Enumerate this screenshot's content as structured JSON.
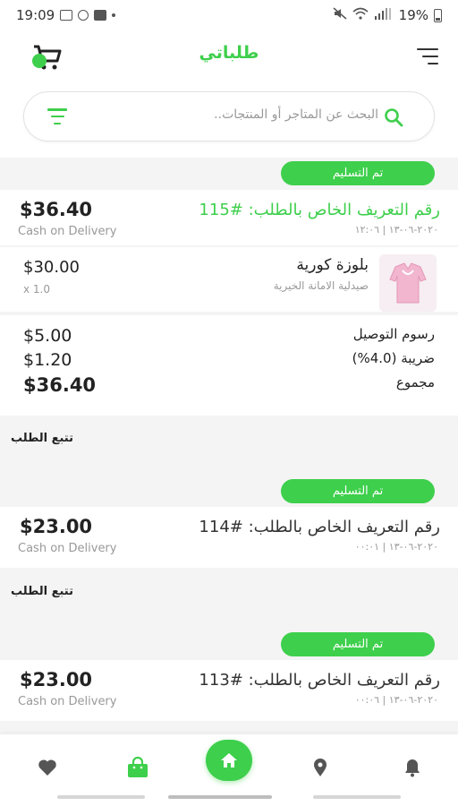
{
  "statusbar": {
    "time": "19:09",
    "battery": "19%"
  },
  "app": {
    "title": "طلباتي"
  },
  "search": {
    "placeholder": "البحث عن المتاجر أو المنتجات.."
  },
  "colors": {
    "accent": "#3ecf4c"
  },
  "orders": [
    {
      "status": "تم التسليم",
      "id_label": "رقم التعريف الخاص بالطلب: #115",
      "date": "٢٠٢٠-٠٦-١٣ | ١٢:٠٦",
      "total": "$36.40",
      "payment": "Cash on Delivery",
      "items": [
        {
          "name": "بلوزة كورية",
          "store": "صيدلية الامانة الخيرية",
          "price": "$30.00",
          "qty": "x 1.0"
        }
      ],
      "fees": [
        {
          "label": "رسوم التوصيل",
          "value": "$5.00"
        },
        {
          "label": "ضريبة (4.0%)",
          "value": "$1.20"
        },
        {
          "label": "مجموع",
          "value": "$36.40"
        }
      ],
      "track_label": "تتبع الطلب"
    },
    {
      "status": "تم التسليم",
      "id_label": "رقم التعريف الخاص بالطلب: #114",
      "date": "٢٠٢٠-٠٦-١٣ | ٠٠:٠١",
      "total": "$23.00",
      "payment": "Cash on Delivery",
      "track_label": "تتبع الطلب"
    },
    {
      "status": "تم التسليم",
      "id_label": "رقم التعريف الخاص بالطلب: #113",
      "date": "٢٠٢٠-٠٦-١٣ | ٠٠:٠٦",
      "total": "$23.00",
      "payment": "Cash on Delivery"
    }
  ],
  "bottomnav": [
    "heart-icon",
    "shopping-bag-icon",
    "home-icon",
    "location-pin-icon",
    "bell-icon"
  ]
}
